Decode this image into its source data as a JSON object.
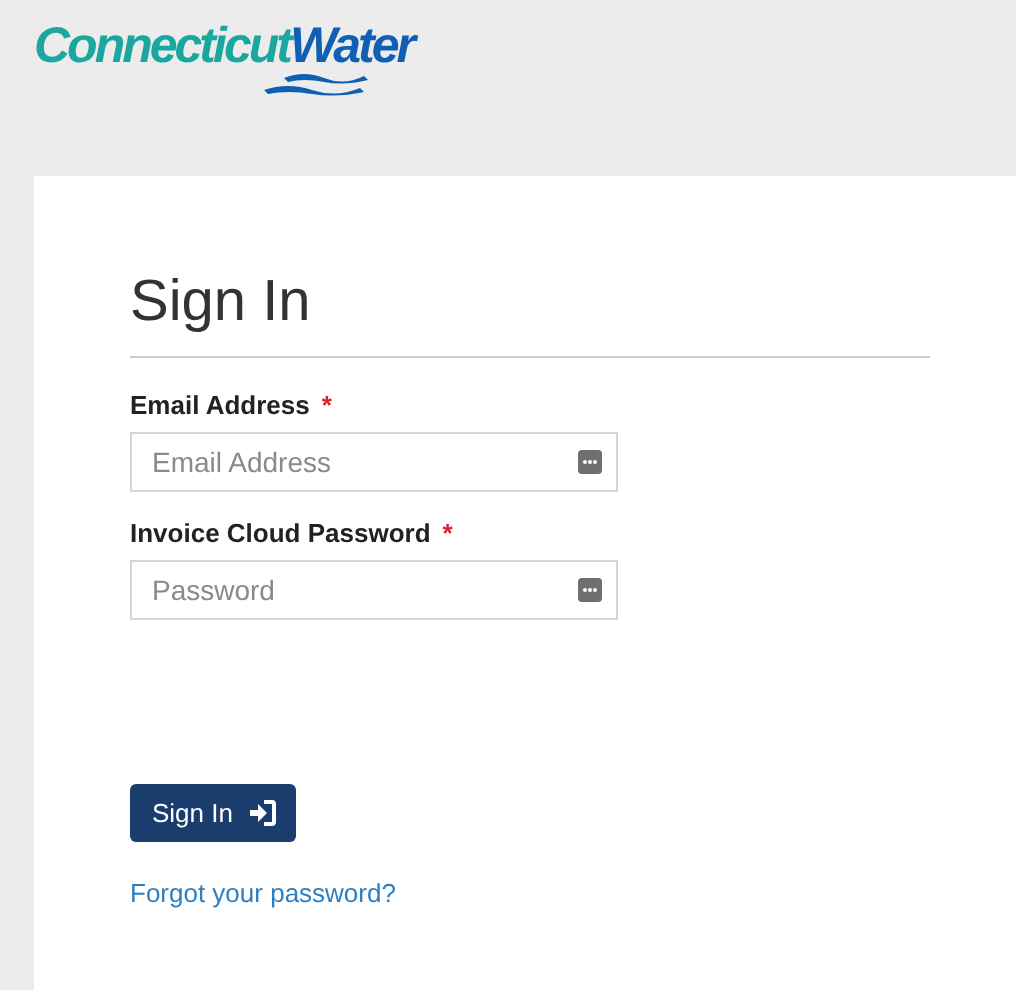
{
  "logo": {
    "part_1": "Connecticut",
    "part_2": "Water"
  },
  "form": {
    "title": "Sign In",
    "fields": [
      {
        "label": "Email Address",
        "required_mark": "*",
        "placeholder": "Email Address"
      },
      {
        "label": "Invoice Cloud Password",
        "required_mark": "*",
        "placeholder": "Password"
      }
    ],
    "submit": "Sign In",
    "link": "Forgot your password?"
  }
}
